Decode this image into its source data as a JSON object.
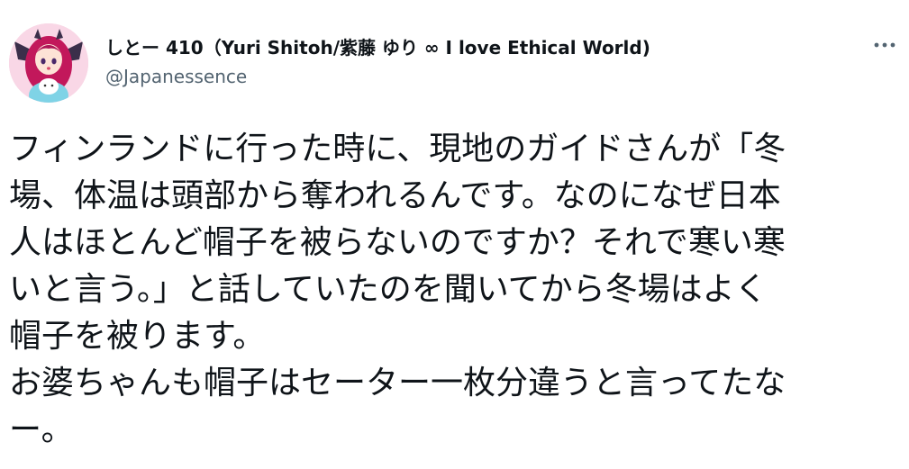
{
  "author": {
    "display_name": "しとー 410（Yuri Shitoh/紫藤 ゆり ∞ I love Ethical World)",
    "handle": "@Japanessence",
    "avatar_icon": "avatar-illustration-icon"
  },
  "more_icon": "more-horizontal-icon",
  "tweet": {
    "lines": [
      "フィンランドに行った時に、現地のガイドさんが「冬",
      "場、体温は頭部から奪われるんです。なのになぜ日本",
      "人はほとんど帽子を被らないのですか？それで寒い寒",
      "いと言う。」と話していたのを聞いてから冬場はよく",
      "帽子を被ります。",
      "お婆ちゃんも帽子はセーター一枚分違うと言ってたな",
      "ー。"
    ]
  },
  "colors": {
    "text": "#0f1419",
    "secondary": "#536471",
    "avatar_bg": "#f7cfe0",
    "hair": "#c2185b",
    "wing": "#3b2f4a"
  }
}
